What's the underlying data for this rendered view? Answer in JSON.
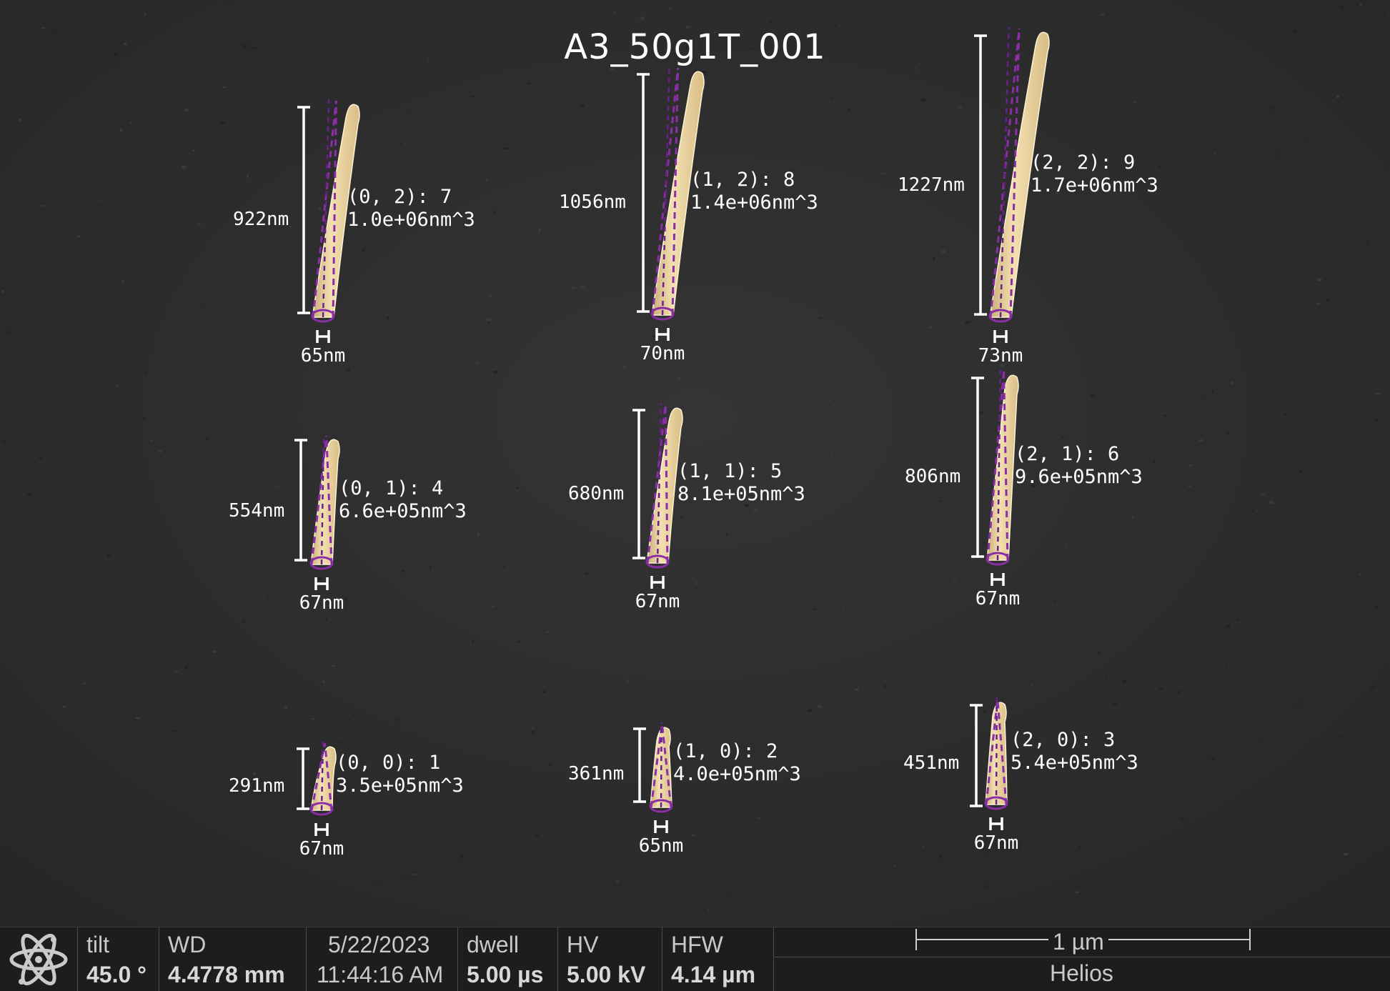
{
  "title": "A3_50g1T_001",
  "colors": {
    "background": "#2e2e2e",
    "pillar": "#eed8a6",
    "fit_lines": "#8a2ea6",
    "bar_background": "#1d1d1d"
  },
  "nanopillars": [
    {
      "label": "(0, 0): 1",
      "volume": "3.5e+05nm^3",
      "height": "291nm",
      "width": "67nm"
    },
    {
      "label": "(1, 0): 2",
      "volume": "4.0e+05nm^3",
      "height": "361nm",
      "width": "65nm"
    },
    {
      "label": "(2, 0): 3",
      "volume": "5.4e+05nm^3",
      "height": "451nm",
      "width": "67nm"
    },
    {
      "label": "(0, 1): 4",
      "volume": "6.6e+05nm^3",
      "height": "554nm",
      "width": "67nm"
    },
    {
      "label": "(1, 1): 5",
      "volume": "8.1e+05nm^3",
      "height": "680nm",
      "width": "67nm"
    },
    {
      "label": "(2, 1): 6",
      "volume": "9.6e+05nm^3",
      "height": "806nm",
      "width": "67nm"
    },
    {
      "label": "(0, 2): 7",
      "volume": "1.0e+06nm^3",
      "height": "922nm",
      "width": "65nm"
    },
    {
      "label": "(1, 2): 8",
      "volume": "1.4e+06nm^3",
      "height": "1056nm",
      "width": "70nm"
    },
    {
      "label": "(2, 2): 9",
      "volume": "1.7e+06nm^3",
      "height": "1227nm",
      "width": "73nm"
    }
  ],
  "info_bar": {
    "logo_icon": "atom-logo-icon",
    "tilt": {
      "label": "tilt",
      "value": "45.0 °"
    },
    "wd": {
      "label": "WD",
      "value": "4.4778 mm"
    },
    "date": {
      "date": "5/22/2023",
      "time": "11:44:16 AM"
    },
    "dwell": {
      "label": "dwell",
      "value": "5.00 µs"
    },
    "hv": {
      "label": "HV",
      "value": "5.00 kV"
    },
    "hfw": {
      "label": "HFW",
      "value": "4.14 µm"
    },
    "scale_bar": "1 µm",
    "instrument": "Helios"
  }
}
